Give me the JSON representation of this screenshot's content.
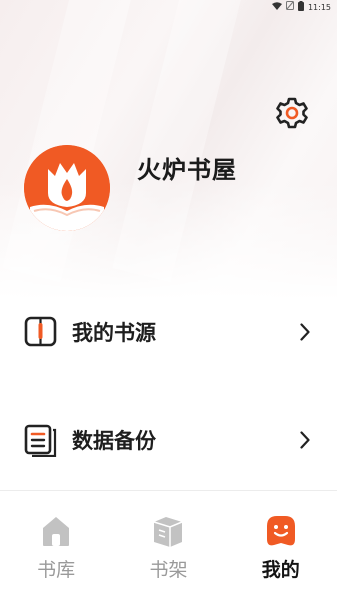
{
  "status_bar": {
    "time": "11:15"
  },
  "profile": {
    "app_name": "火炉书屋"
  },
  "menu": [
    {
      "label": "我的书源",
      "icon": "book-source-icon"
    },
    {
      "label": "数据备份",
      "icon": "backup-icon"
    }
  ],
  "nav": [
    {
      "label": "书库",
      "icon": "home-icon",
      "active": false
    },
    {
      "label": "书架",
      "icon": "bookshelf-icon",
      "active": false
    },
    {
      "label": "我的",
      "icon": "profile-face-icon",
      "active": true
    }
  ],
  "colors": {
    "accent": "#f05a24",
    "inactive": "#c2c2c2"
  }
}
